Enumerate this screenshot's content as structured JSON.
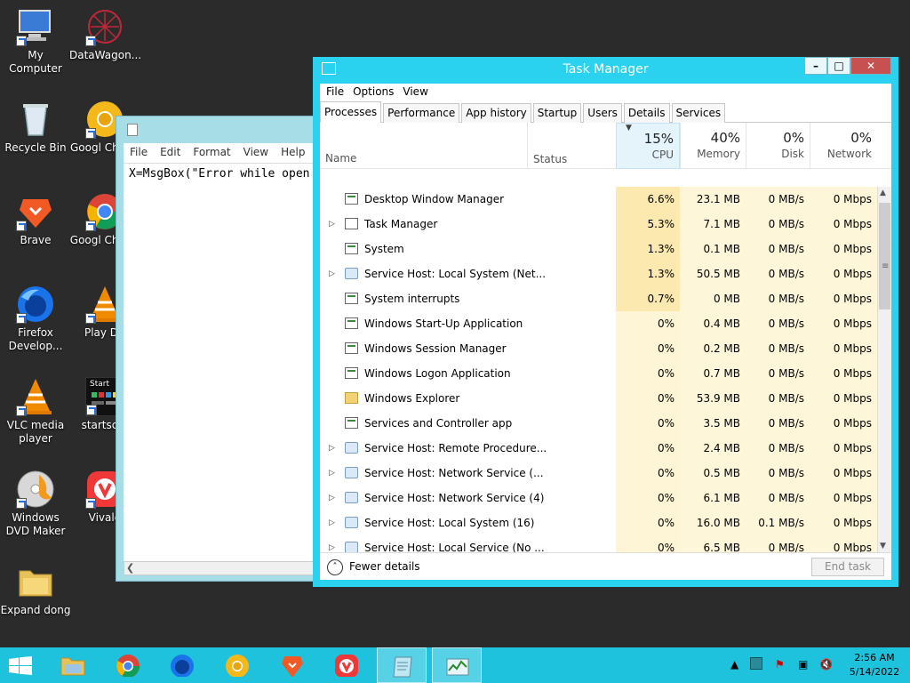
{
  "desktop": {
    "icons": [
      {
        "label": "My Computer",
        "icon": "computer-icon"
      },
      {
        "label": "DataWagon...",
        "icon": "datawagon-icon"
      },
      {
        "label": "Recycle Bin",
        "icon": "recycle-bin-icon"
      },
      {
        "label": "Googl Chro...",
        "icon": "chrome-canary-icon"
      },
      {
        "label": "Brave",
        "icon": "brave-icon"
      },
      {
        "label": "Googl Chrom",
        "icon": "chrome-icon"
      },
      {
        "label": "Firefox Develop...",
        "icon": "firefox-dev-icon"
      },
      {
        "label": "Play DV",
        "icon": "vlc-icon"
      },
      {
        "label": "VLC media player",
        "icon": "vlc-icon"
      },
      {
        "label": "startscre",
        "icon": "startscreen-icon"
      },
      {
        "label": "Windows DVD Maker",
        "icon": "dvd-maker-icon"
      },
      {
        "label": "Vivald",
        "icon": "vivaldi-icon"
      },
      {
        "label": "Expand dong",
        "icon": "folder-icon"
      }
    ],
    "startscreen_caption": "Start"
  },
  "notepad": {
    "menu": [
      "File",
      "Edit",
      "Format",
      "View",
      "Help"
    ],
    "content": "X=MsgBox(\"Error while open"
  },
  "taskmanager": {
    "title": "Task Manager",
    "menu": [
      "File",
      "Options",
      "View"
    ],
    "tabs": [
      "Processes",
      "Performance",
      "App history",
      "Startup",
      "Users",
      "Details",
      "Services"
    ],
    "active_tab": "Processes",
    "columns": {
      "name": "Name",
      "status": "Status",
      "cpu": {
        "pct": "15%",
        "label": "CPU"
      },
      "memory": {
        "pct": "40%",
        "label": "Memory"
      },
      "disk": {
        "pct": "0%",
        "label": "Disk"
      },
      "network": {
        "pct": "0%",
        "label": "Network"
      }
    },
    "processes": [
      {
        "name": "Desktop Window Manager",
        "cpu": "6.6%",
        "mem": "23.1 MB",
        "disk": "0 MB/s",
        "net": "0 Mbps",
        "expandable": false,
        "icon": "sys"
      },
      {
        "name": "Task Manager",
        "cpu": "5.3%",
        "mem": "7.1 MB",
        "disk": "0 MB/s",
        "net": "0 Mbps",
        "expandable": true,
        "icon": "tm"
      },
      {
        "name": "System",
        "cpu": "1.3%",
        "mem": "0.1 MB",
        "disk": "0 MB/s",
        "net": "0 Mbps",
        "expandable": false,
        "icon": "sys"
      },
      {
        "name": "Service Host: Local System (Net...",
        "cpu": "1.3%",
        "mem": "50.5 MB",
        "disk": "0 MB/s",
        "net": "0 Mbps",
        "expandable": true,
        "icon": "svc"
      },
      {
        "name": "System interrupts",
        "cpu": "0.7%",
        "mem": "0 MB",
        "disk": "0 MB/s",
        "net": "0 Mbps",
        "expandable": false,
        "icon": "sys"
      },
      {
        "name": "Windows Start-Up Application",
        "cpu": "0%",
        "mem": "0.4 MB",
        "disk": "0 MB/s",
        "net": "0 Mbps",
        "expandable": false,
        "icon": "sys"
      },
      {
        "name": "Windows Session Manager",
        "cpu": "0%",
        "mem": "0.2 MB",
        "disk": "0 MB/s",
        "net": "0 Mbps",
        "expandable": false,
        "icon": "sys"
      },
      {
        "name": "Windows Logon Application",
        "cpu": "0%",
        "mem": "0.7 MB",
        "disk": "0 MB/s",
        "net": "0 Mbps",
        "expandable": false,
        "icon": "sys"
      },
      {
        "name": "Windows Explorer",
        "cpu": "0%",
        "mem": "53.9 MB",
        "disk": "0 MB/s",
        "net": "0 Mbps",
        "expandable": false,
        "icon": "folder"
      },
      {
        "name": "Services and Controller app",
        "cpu": "0%",
        "mem": "3.5 MB",
        "disk": "0 MB/s",
        "net": "0 Mbps",
        "expandable": false,
        "icon": "sys"
      },
      {
        "name": "Service Host: Remote Procedure...",
        "cpu": "0%",
        "mem": "2.4 MB",
        "disk": "0 MB/s",
        "net": "0 Mbps",
        "expandable": true,
        "icon": "svc"
      },
      {
        "name": "Service Host: Network Service (...",
        "cpu": "0%",
        "mem": "0.5 MB",
        "disk": "0 MB/s",
        "net": "0 Mbps",
        "expandable": true,
        "icon": "svc"
      },
      {
        "name": "Service Host: Network Service (4)",
        "cpu": "0%",
        "mem": "6.1 MB",
        "disk": "0 MB/s",
        "net": "0 Mbps",
        "expandable": true,
        "icon": "svc"
      },
      {
        "name": "Service Host: Local System (16)",
        "cpu": "0%",
        "mem": "16.0 MB",
        "disk": "0.1 MB/s",
        "net": "0 Mbps",
        "expandable": true,
        "icon": "svc"
      },
      {
        "name": "Service Host: Local Service (No ...",
        "cpu": "0%",
        "mem": "6.5 MB",
        "disk": "0 MB/s",
        "net": "0 Mbps",
        "expandable": true,
        "icon": "svc"
      }
    ],
    "fewer_details": "Fewer details",
    "end_task": "End task"
  },
  "taskbar": {
    "time": "2:56 AM",
    "date": "5/14/2022",
    "items": [
      "file-explorer-icon",
      "chrome-icon",
      "firefox-dev-icon",
      "chrome-canary-icon",
      "brave-icon",
      "vivaldi-icon",
      "notepad-icon",
      "task-manager-icon"
    ]
  },
  "colors": {
    "window_accent": "#2bd2ef",
    "taskbar": "#1fc2dc",
    "cpu_heat_strong": "#fbe9b0",
    "cpu_heat_light": "#fdf5d6",
    "heat_col": "#fef6d9"
  }
}
